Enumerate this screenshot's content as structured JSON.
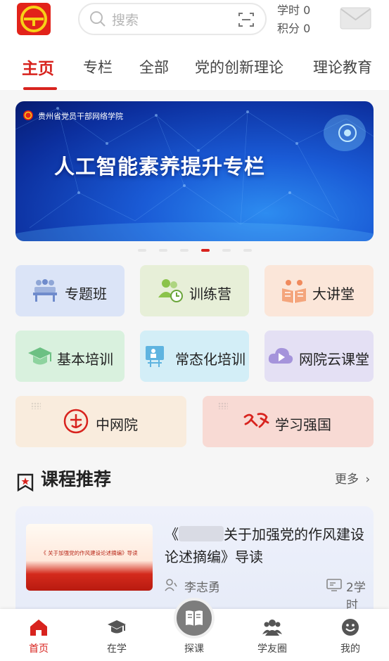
{
  "header": {
    "search_placeholder": "搜索",
    "study_hours": "学时 0",
    "points": "积分 0"
  },
  "tabs": [
    "主页",
    "专栏",
    "全部",
    "党的创新理论",
    "理论教育"
  ],
  "banner": {
    "org": "贵州省党员干部网络学院",
    "title": "人工智能素养提升专栏",
    "carousel_count": 6,
    "carousel_active": 4
  },
  "tiles": [
    {
      "label": "专题班",
      "icon": "classroom-icon",
      "color": "#dbe4f7"
    },
    {
      "label": "训练营",
      "icon": "team-icon",
      "color": "#e7efd8"
    },
    {
      "label": "大讲堂",
      "icon": "book-icon",
      "color": "#fbe6d9"
    },
    {
      "label": "基本培训",
      "icon": "graduation-cap-icon",
      "color": "#d9f1de"
    },
    {
      "label": "常态化培训",
      "icon": "presentation-icon",
      "color": "#d3eef7"
    },
    {
      "label": "网院云课堂",
      "icon": "cloud-play-icon",
      "color": "#e4e0f4"
    },
    {
      "label": "中网院",
      "icon": "zhongwangyuan-logo-icon",
      "color": "#f9ecdd"
    },
    {
      "label": "学习强国",
      "icon": "xuexiqiangguo-logo-icon",
      "color": "#f8dad4"
    }
  ],
  "section": {
    "title": "课程推荐",
    "more": "更多"
  },
  "course": {
    "title_before": "《",
    "title_after": "关于加强党的作风建设论述摘编》导读",
    "thumb_text": "《      关于加强党的作风建设论述摘编》导读",
    "author": "李志勇",
    "hours": "2学时"
  },
  "bottom_nav": [
    {
      "label": "首页",
      "icon": "home-icon"
    },
    {
      "label": "在学",
      "icon": "graduation-cap-icon"
    },
    {
      "label": "探课",
      "icon": "open-book-icon"
    },
    {
      "label": "学友圈",
      "icon": "friends-icon"
    },
    {
      "label": "我的",
      "icon": "smile-icon"
    }
  ],
  "colors": {
    "brand_red": "#d8231e",
    "banner_blue": "#1a5bd6"
  }
}
